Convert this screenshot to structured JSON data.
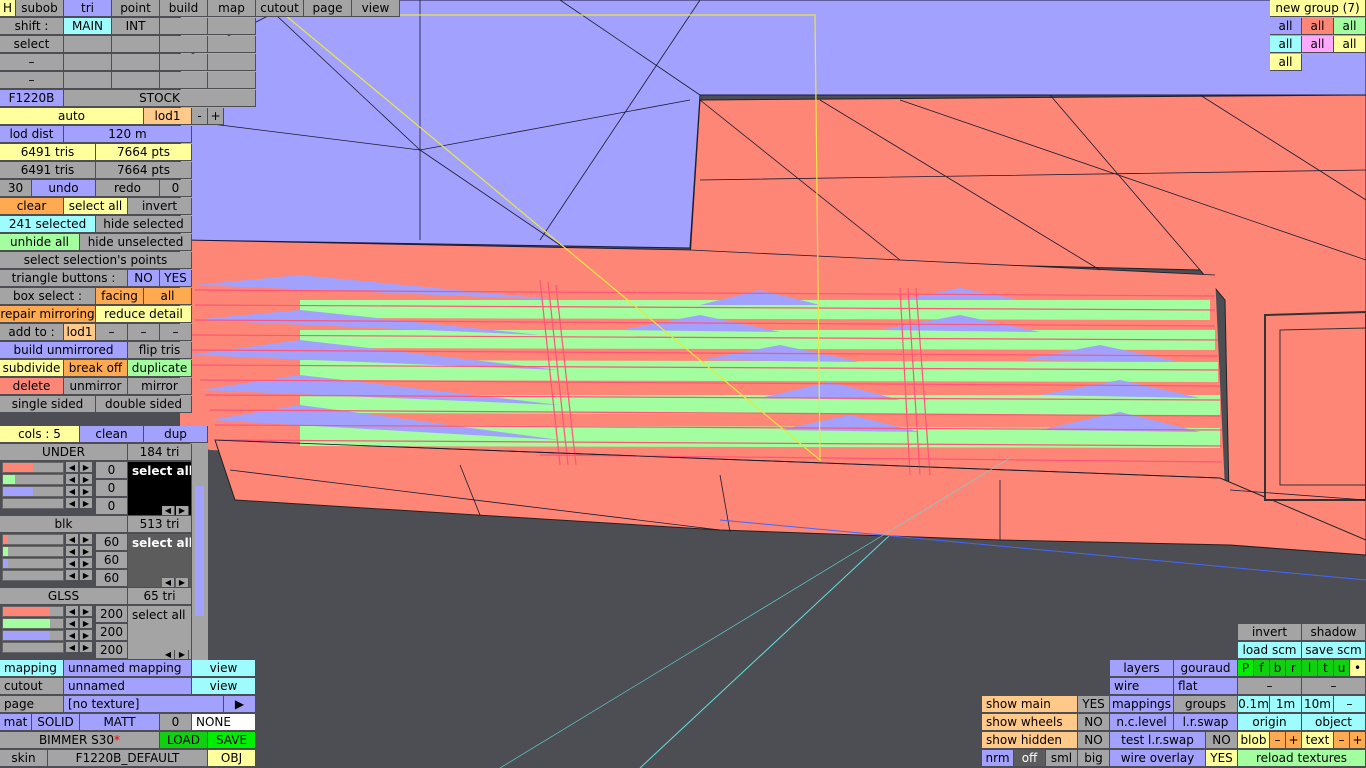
{
  "menubar": {
    "h": "H",
    "subob": "subob",
    "tri": "tri",
    "point": "point",
    "build": "build",
    "map": "map",
    "cutout": "cutout",
    "page": "page",
    "view": "view"
  },
  "shift": {
    "label": "shift :",
    "main": "MAIN",
    "int": "INT"
  },
  "select_label": "select",
  "dash": "–",
  "model": {
    "name": "F1220B",
    "variant": "STOCK"
  },
  "lod": {
    "auto": "auto",
    "lod": "lod1",
    "minus": "-",
    "plus": "+",
    "dist_label": "lod dist",
    "dist_value": "120 m"
  },
  "stats": {
    "tris1": "6491 tris",
    "pts1": "7664 pts",
    "tris2": "6491 tris",
    "pts2": "7664 pts"
  },
  "undo": {
    "count": "30",
    "undo": "undo",
    "redo": "redo",
    "redo_count": "0"
  },
  "ops": {
    "clear": "clear",
    "select_all": "select all",
    "invert": "invert",
    "selected": "241 selected",
    "hide_selected": "hide selected",
    "unhide_all": "unhide all",
    "hide_unselected": "hide unselected",
    "select_points": "select selection's points",
    "tri_buttons": "triangle buttons :",
    "no": "NO",
    "yes": "YES",
    "box_select": "box select :",
    "facing": "facing",
    "all": "all",
    "repair": "repair mirroring",
    "reduce": "reduce detail",
    "add_to": "add to :",
    "add_lod": "lod1",
    "build_unmirrored": "build unmirrored",
    "flip": "flip tris",
    "subdivide": "subdivide",
    "break_off": "break off",
    "duplicate": "duplicate",
    "delete": "delete",
    "unmirror": "unmirror",
    "mirror": "mirror",
    "single": "single sided",
    "double": "double sided"
  },
  "cols": {
    "label": "cols : 5",
    "clean": "clean",
    "dup": "dup"
  },
  "materials": [
    {
      "name": "UNDER",
      "tris": "184 tri",
      "vals": [
        "0",
        "0",
        "0"
      ],
      "sel": "select all",
      "fill": [
        0.5,
        0.2,
        0.5,
        0.2
      ]
    },
    {
      "name": "blk",
      "tris": "513 tri",
      "vals": [
        "60",
        "60",
        "60"
      ],
      "sel": "select all",
      "fill": [
        0.08,
        0.08,
        0.08,
        0.08
      ]
    },
    {
      "name": "GLSS",
      "tris": "65 tri",
      "vals": [
        "200",
        "200",
        "200"
      ],
      "sel": "select all",
      "fill": [
        0.78,
        0.78,
        0.78,
        0.78
      ]
    }
  ],
  "bottom_left": {
    "mapping": "mapping",
    "mapping_val": "unnamed mapping",
    "view": "view",
    "cutout": "cutout",
    "cutout_val": "unnamed",
    "page": "page",
    "page_val": "[no texture]",
    "arrow": "▶",
    "mat": "mat",
    "solid": "SOLID",
    "matt": "MATT",
    "zero": "0",
    "none": "NONE",
    "car": "BIMMER S30",
    "star": "*",
    "load": "LOAD",
    "save": "SAVE",
    "skin": "skin",
    "skin_val": "F1220B_DEFAULT",
    "obj": "OBJ"
  },
  "groups": {
    "title": "new group (7)",
    "all": "all"
  },
  "bottom_right": {
    "show_main": "show main",
    "show_wheels": "show wheels",
    "show_hidden": "show hidden",
    "yes": "YES",
    "no": "NO",
    "nrm": "nrm",
    "off": "off",
    "sml": "sml",
    "big": "big",
    "layers": "layers",
    "gouraud": "gouraud",
    "wire": "wire",
    "flat": "flat",
    "mappings": "mappings",
    "groups": "groups",
    "nclevel": "n.c.level",
    "lrswap": "l.r.swap",
    "test_lr": "test l.r.swap",
    "wire_overlay": "wire overlay",
    "invert": "invert",
    "shadow": "shadow",
    "load_scm": "load scm",
    "save_scm": "save scm",
    "letters": [
      "P",
      "f",
      "b",
      "r",
      "l",
      "t",
      "u",
      "•"
    ],
    "d01": "0.1m",
    "d1": "1m",
    "d10": "10m",
    "origin": "origin",
    "object": "object",
    "blob": "blob",
    "text": "text",
    "minus": "–",
    "plus": "+",
    "reload": "reload textures"
  },
  "colors": {
    "blue": "#a3a1fe",
    "salmon": "#fd8677",
    "green": "#a2fe9f",
    "grey": "#4d4e54"
  }
}
